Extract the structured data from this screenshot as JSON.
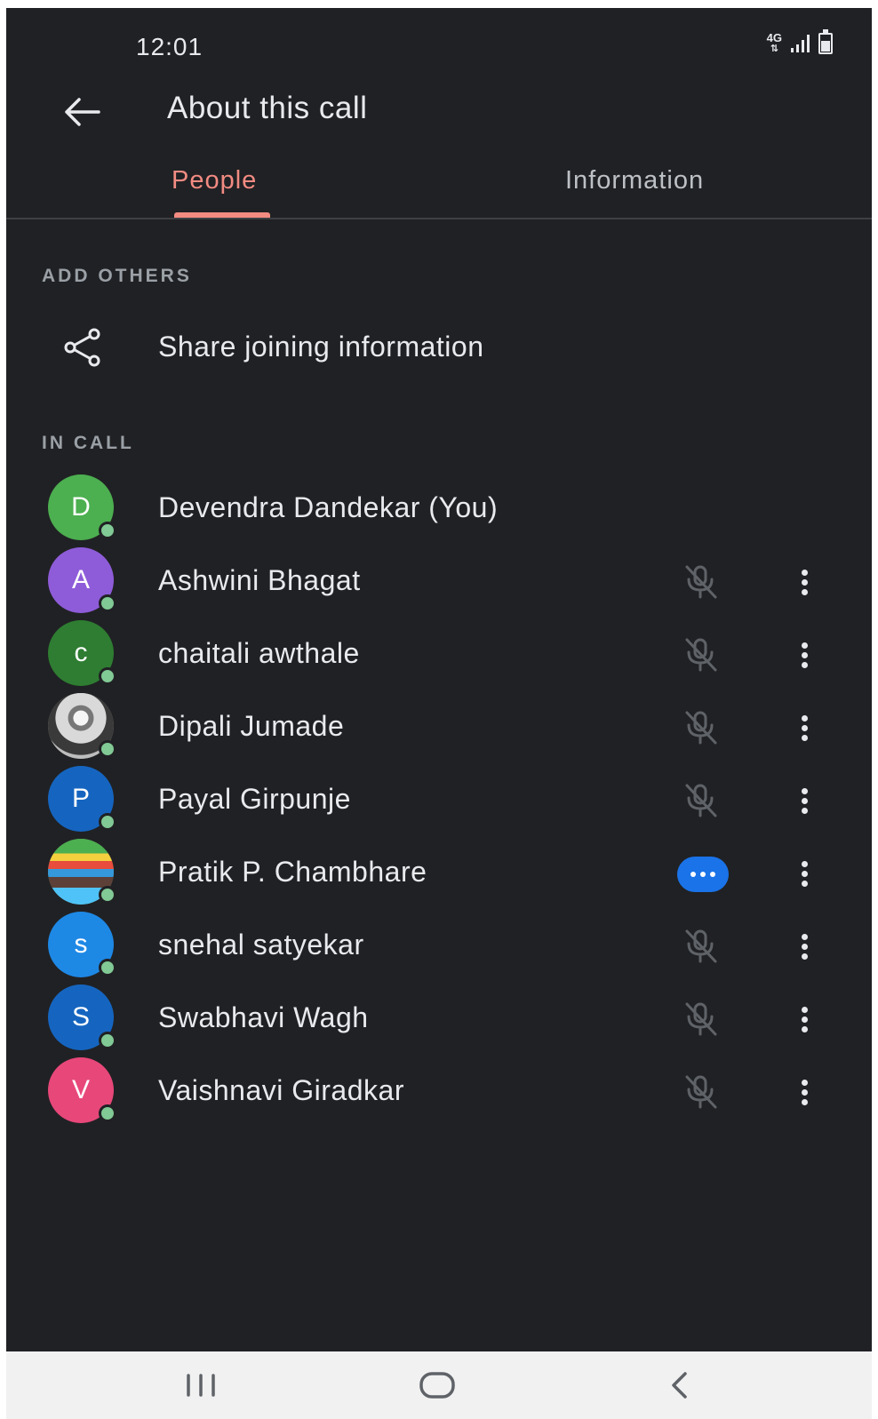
{
  "status_bar": {
    "time": "12:01",
    "network": "4G"
  },
  "app_bar": {
    "title": "About this call",
    "back_icon": "arrow-left-icon"
  },
  "tabs": [
    {
      "label": "People",
      "selected": true
    },
    {
      "label": "Information",
      "selected": false
    }
  ],
  "add_others": {
    "heading": "ADD OTHERS",
    "share_label": "Share joining information",
    "share_icon": "share-icon"
  },
  "in_call": {
    "heading": "IN CALL",
    "participants": [
      {
        "name": "Devendra Dandekar (You)",
        "initial": "D",
        "color": "#4caf50",
        "status": "none"
      },
      {
        "name": "Ashwini Bhagat",
        "initial": "A",
        "color": "#8e5cd9",
        "status": "muted"
      },
      {
        "name": "chaitali awthale",
        "initial": "c",
        "color": "#2e7d32",
        "status": "muted"
      },
      {
        "name": "Dipali Jumade",
        "initial": "",
        "color": "#9e9e9e",
        "status": "muted",
        "photo": true
      },
      {
        "name": "Payal Girpunje",
        "initial": "P",
        "color": "#1565c0",
        "status": "muted"
      },
      {
        "name": "Pratik P. Chambhare",
        "initial": "",
        "color": "#6d8f6a",
        "status": "speaking",
        "photo": true
      },
      {
        "name": "snehal satyekar",
        "initial": "s",
        "color": "#1e88e5",
        "status": "muted"
      },
      {
        "name": "Swabhavi Wagh",
        "initial": "S",
        "color": "#1565c0",
        "status": "muted"
      },
      {
        "name": "Vaishnavi Giradkar",
        "initial": "V",
        "color": "#e8477a",
        "status": "muted"
      }
    ]
  },
  "colors": {
    "background": "#202124",
    "accent": "#f28b82",
    "speaking": "#1a73e8",
    "presence": "#81c995"
  },
  "nav_bar": {
    "recents_icon": "recents-icon",
    "home_icon": "home-icon",
    "back_icon": "nav-back-icon"
  }
}
